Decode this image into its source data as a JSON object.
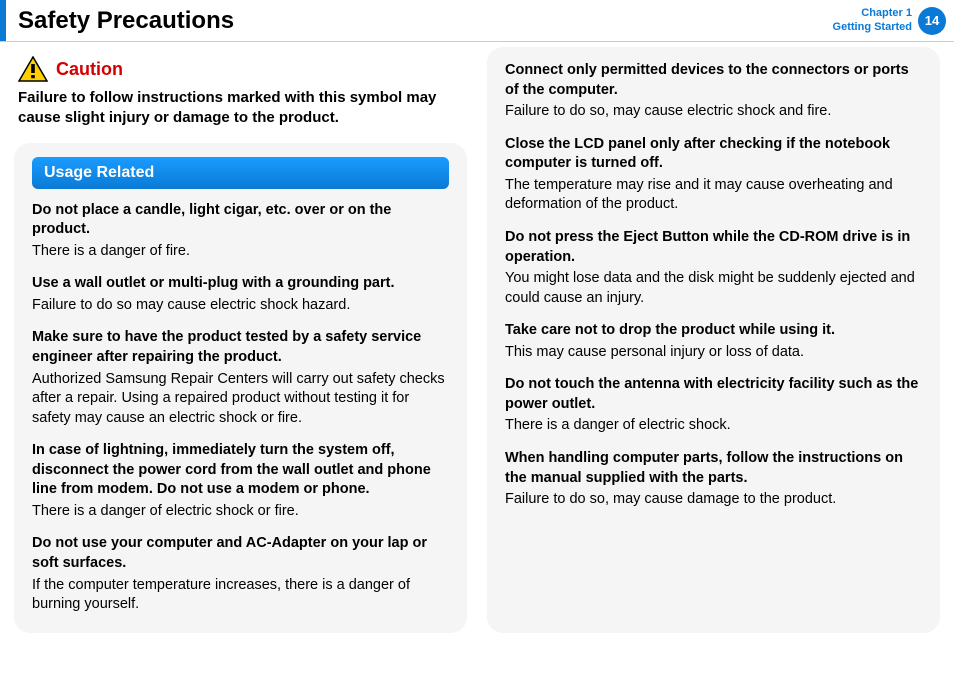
{
  "header": {
    "title": "Safety Precautions",
    "chapter_line1": "Chapter 1",
    "chapter_line2": "Getting Started",
    "page_num": "14"
  },
  "caution": {
    "label": "Caution",
    "desc": "Failure to follow instructions marked with this symbol may cause slight injury or damage to the product."
  },
  "section_title": "Usage Related",
  "left": [
    {
      "head": "Do not place a candle, light cigar, etc. over or on the product.",
      "body": "There is a danger of fire."
    },
    {
      "head": "Use a wall outlet or multi-plug with a grounding part.",
      "body": "Failure to do so may cause electric shock hazard."
    },
    {
      "head": "Make sure to have the product tested by a safety service engineer after repairing the product.",
      "body": "Authorized Samsung Repair Centers will carry out safety checks after a repair. Using a repaired product without testing it for safety may cause an electric shock or fire."
    },
    {
      "head": "In case of lightning, immediately turn the system off, disconnect the power cord from the wall outlet and phone line from modem. Do not use a modem or phone.",
      "body": "There is a danger of electric shock or fire."
    },
    {
      "head": "Do not use your computer and AC-Adapter on your lap or soft surfaces.",
      "body": "If the computer temperature increases, there is a danger of burning yourself."
    }
  ],
  "right": [
    {
      "head": "Connect only permitted devices to the connectors or ports of the computer.",
      "body": "Failure to do so, may cause electric shock and fire."
    },
    {
      "head": "Close the LCD panel only after checking if the notebook computer is turned off.",
      "body": "The temperature may rise and it may cause overheating and deformation of the product."
    },
    {
      "head": "Do not press the Eject Button while the CD-ROM drive is in operation.",
      "body": "You might lose data and the disk might be suddenly ejected and could cause an injury."
    },
    {
      "head": "Take care not to drop the product while using it.",
      "body": "This may cause personal injury or loss of data."
    },
    {
      "head": "Do not touch the antenna with electricity facility such as the power outlet.",
      "body": "There is a danger of electric shock."
    },
    {
      "head": "When handling computer parts, follow the instructions on the manual supplied with the parts.",
      "body": "Failure to do so, may cause damage to the product."
    }
  ]
}
